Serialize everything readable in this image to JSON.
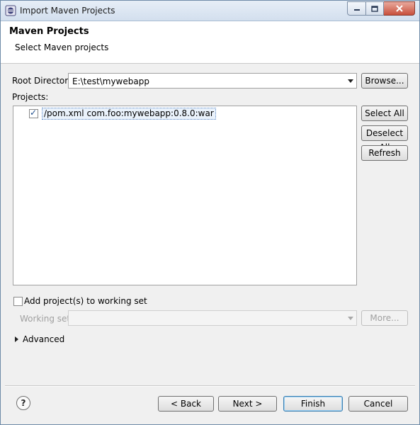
{
  "window": {
    "title": "Import Maven Projects",
    "colors": {
      "title_bar": "#d9e4f1",
      "close_button": "#c8503c",
      "default_button_border": "#3c7fb1"
    }
  },
  "header": {
    "title": "Maven Projects",
    "subtitle": "Select Maven projects"
  },
  "root_directory": {
    "label": "Root Directory:",
    "value": "E:\\test\\mywebapp",
    "browse_label": "Browse..."
  },
  "projects": {
    "label": "Projects:",
    "items": [
      {
        "label": "/pom.xml  com.foo:mywebapp:0.8.0:war",
        "checked": true
      }
    ],
    "select_all_label": "Select All",
    "deselect_all_label": "Deselect All",
    "refresh_label": "Refresh"
  },
  "working_set": {
    "checkbox_label": "Add project(s) to working set",
    "checked": false,
    "label": "Working set:",
    "value": "",
    "more_label": "More..."
  },
  "advanced": {
    "label": "Advanced",
    "icon": "chevron-right-icon"
  },
  "footer": {
    "help_icon": "help-icon",
    "back_label": "< Back",
    "next_label": "Next >",
    "finish_label": "Finish",
    "cancel_label": "Cancel"
  }
}
